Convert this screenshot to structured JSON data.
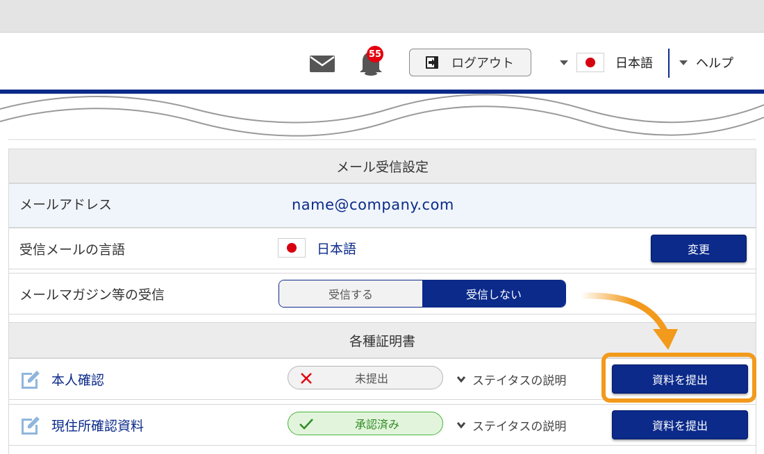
{
  "header": {
    "mail_icon": "envelope-icon",
    "notification_count": "55",
    "logout_label": "ログアウト",
    "language_label": "日本語",
    "help_label": "ヘルプ"
  },
  "mail_settings": {
    "section_title": "メール受信設定",
    "email_label": "メールアドレス",
    "email_value": "name@company.com",
    "mail_language_label": "受信メールの言語",
    "mail_language_value": "日本語",
    "change_button": "変更",
    "newsletter_label": "メールマガジン等の受信",
    "newsletter_options": [
      "受信する",
      "受信しない"
    ],
    "newsletter_selected": "受信しない"
  },
  "certificates": {
    "section_title": "各種証明書",
    "items": [
      {
        "name": "本人確認",
        "status": "未提出",
        "status_help": "ステイタスの説明",
        "action": "資料を提出"
      },
      {
        "name": "現住所確認資料",
        "status": "承認済み",
        "status_help": "ステイタスの説明",
        "action": "資料を提出"
      }
    ]
  },
  "colors": {
    "primary": "#0b2a8a",
    "highlight": "#f29a1c",
    "badge": "#e3000f",
    "approved": "#46b23c",
    "pending_x": "#e3000f"
  }
}
